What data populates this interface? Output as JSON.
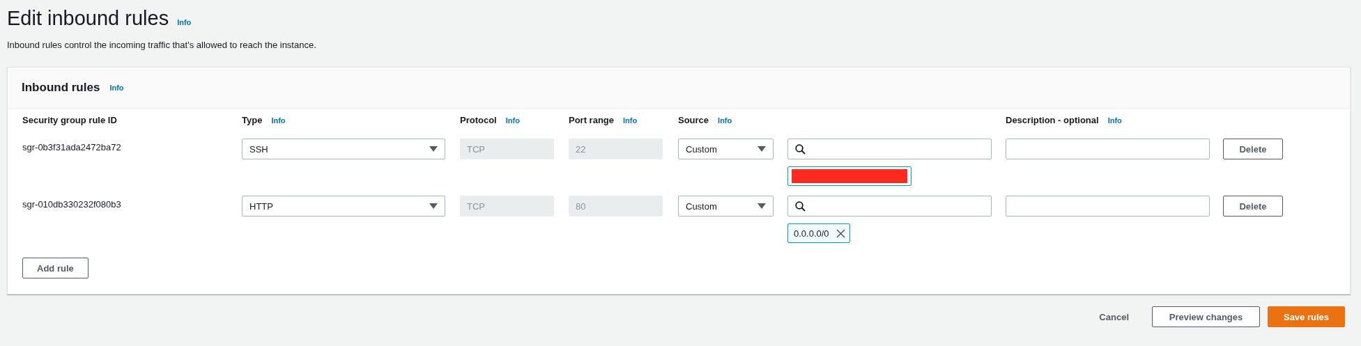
{
  "page": {
    "title": "Edit inbound rules",
    "title_info": "Info",
    "description": "Inbound rules control the incoming traffic that's allowed to reach the instance."
  },
  "panel": {
    "title": "Inbound rules",
    "title_info": "Info",
    "columns": [
      {
        "label": "Security group rule ID"
      },
      {
        "label": "Type",
        "info": "Info"
      },
      {
        "label": "Protocol",
        "info": "Info"
      },
      {
        "label": "Port range",
        "info": "Info"
      },
      {
        "label": "Source",
        "info": "Info"
      },
      {
        "label": "Description - optional",
        "info": "Info"
      }
    ],
    "rows": [
      {
        "rule_id": "sgr-0b3f31ada2472ba72",
        "type": "SSH",
        "protocol": "TCP",
        "port_range": "22",
        "source": "Custom",
        "tokens": [
          {
            "kind": "redacted"
          }
        ],
        "delete": "Delete"
      },
      {
        "rule_id": "sgr-010db330232f080b3",
        "type": "HTTP",
        "protocol": "TCP",
        "port_range": "80",
        "source": "Custom",
        "tokens": [
          {
            "kind": "cidr",
            "text": "0.0.0.0/0"
          }
        ],
        "delete": "Delete"
      }
    ],
    "add_button": "Add rule"
  },
  "footer": {
    "cancel": "Cancel",
    "preview": "Preview changes",
    "save": "Save rules"
  }
}
